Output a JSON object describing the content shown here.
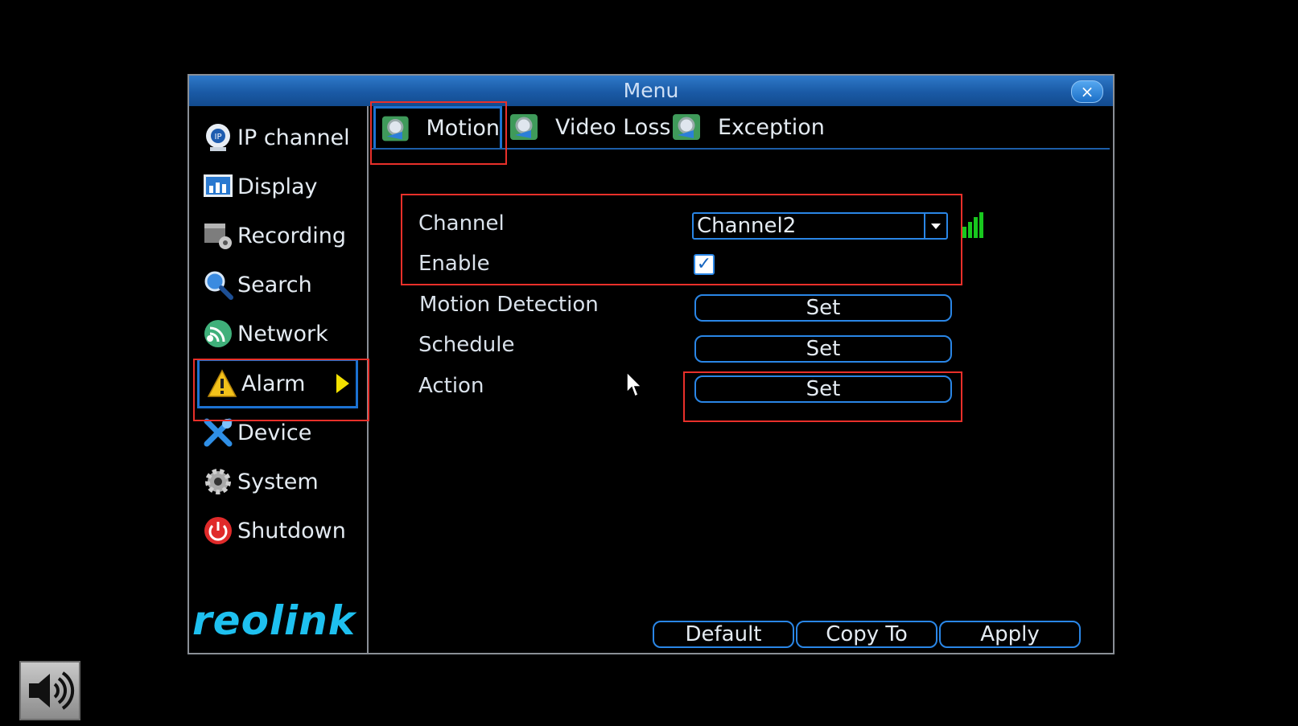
{
  "window": {
    "title": "Menu",
    "close_label": "×"
  },
  "sidebar": {
    "items": [
      {
        "label": "IP channel",
        "icon": "ip-camera-icon"
      },
      {
        "label": "Display",
        "icon": "display-icon"
      },
      {
        "label": "Recording",
        "icon": "recording-icon"
      },
      {
        "label": "Search",
        "icon": "search-icon"
      },
      {
        "label": "Network",
        "icon": "network-icon"
      },
      {
        "label": "Alarm",
        "icon": "alarm-warning-icon",
        "selected": true
      },
      {
        "label": "Device",
        "icon": "device-tools-icon"
      },
      {
        "label": "System",
        "icon": "system-gear-icon"
      },
      {
        "label": "Shutdown",
        "icon": "power-icon"
      }
    ],
    "logo": "reolink"
  },
  "tabs": [
    {
      "label": "Motion",
      "selected": true
    },
    {
      "label": "Video Loss"
    },
    {
      "label": "Exception"
    }
  ],
  "form": {
    "channel_label": "Channel",
    "channel_value": "Channel2",
    "enable_label": "Enable",
    "enable_checked": true,
    "motion_detection_label": "Motion Detection",
    "schedule_label": "Schedule",
    "action_label": "Action",
    "set_label": "Set"
  },
  "footer": {
    "default_label": "Default",
    "copy_to_label": "Copy To",
    "apply_label": "Apply"
  },
  "colors": {
    "accent": "#2a86e6",
    "highlight": "#e8302a",
    "title_bar": "#1a5aa5",
    "logo": "#1ec0ef",
    "signal": "#18c81e"
  }
}
